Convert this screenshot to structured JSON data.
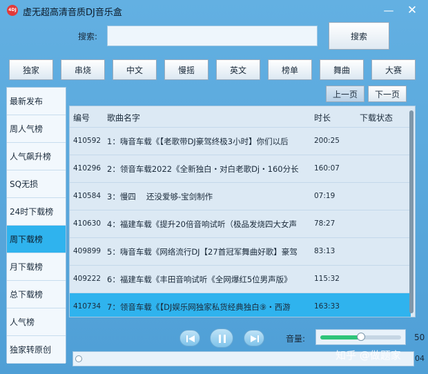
{
  "app": {
    "title": "虚无超高清音质DJ音乐盒",
    "logo_text": "4DJ"
  },
  "search": {
    "label": "搜索:",
    "value": "",
    "placeholder": "",
    "button_label": "搜索"
  },
  "categories": [
    "独家",
    "串烧",
    "中文",
    "慢摇",
    "英文",
    "榜单",
    "舞曲",
    "大赛"
  ],
  "sidebar": {
    "items": [
      "最新发布",
      "周人气榜",
      "人气飙升榜",
      "SQ无损",
      "24时下载榜",
      "周下载榜",
      "月下载榜",
      "总下载榜",
      "人气榜",
      "独家转原创"
    ],
    "active_index": 5
  },
  "paging": {
    "prev_label": "上一页",
    "next_label": "下一页"
  },
  "table": {
    "headers": {
      "id": "编号",
      "name": "歌曲名字",
      "duration": "时长",
      "status": "下载状态"
    },
    "rows": [
      {
        "id": "410592",
        "name": "1：嗨音车载《【老歌带DJ豪驾终极3小时】你们以后",
        "duration": "200:25",
        "status": ""
      },
      {
        "id": "410296",
        "name": "2：领音车载2022《全新独白・对白老歌Dj・160分长",
        "duration": "160:07",
        "status": ""
      },
      {
        "id": "410584",
        "name": "3：慢四　 还没爱够-宝剑制作",
        "duration": "07:19",
        "status": ""
      },
      {
        "id": "410630",
        "name": "4：福建车载《提升20倍音响试听（极品发烧四大女声",
        "duration": "78:27",
        "status": ""
      },
      {
        "id": "409899",
        "name": "5：嗨音车载《网络流行DJ【27首冠军舞曲好歌】豪驾",
        "duration": "83:13",
        "status": ""
      },
      {
        "id": "409222",
        "name": "6：福建车载《丰田音响试听《全网爆红5位男声版》",
        "duration": "115:32",
        "status": ""
      },
      {
        "id": "410734",
        "name": "7：领音车载《【DJ娱乐网独家私货经典独白⑨・西游",
        "duration": "163:33",
        "status": ""
      }
    ],
    "selected_index": 6
  },
  "player": {
    "volume_label": "音量:",
    "volume": 50,
    "volume_value": "50",
    "progress": 0.0,
    "time_readout": "04"
  },
  "watermark": "知乎 @做题家",
  "colors": {
    "accent": "#2fb3ee",
    "window_bg": "#5aa9dd",
    "volume_fill": "#2ec47a"
  }
}
